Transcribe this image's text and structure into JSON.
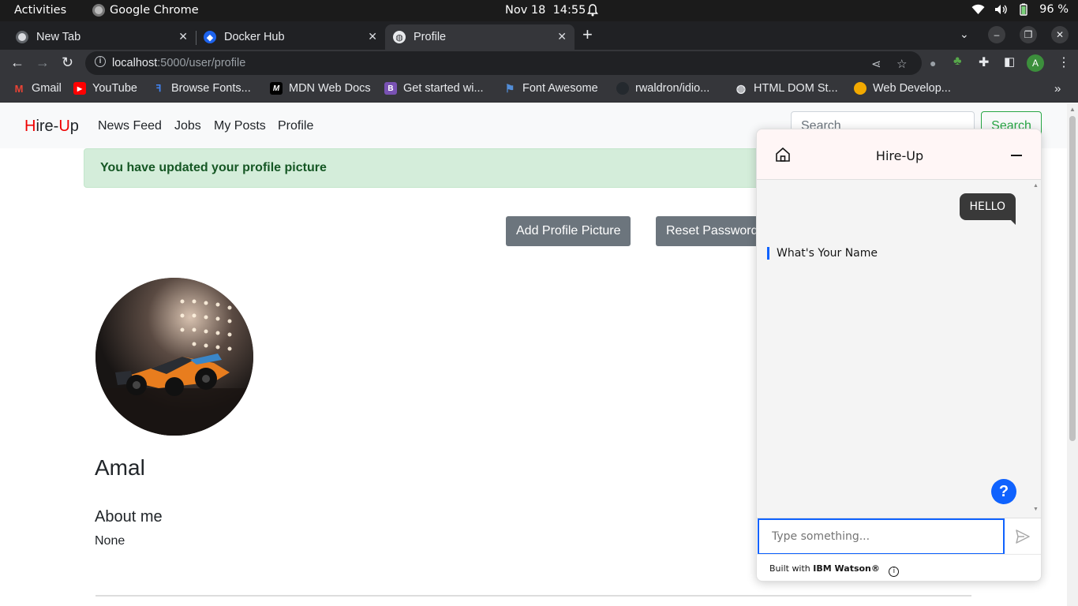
{
  "system": {
    "activities": "Activities",
    "app_name": "Google Chrome",
    "date": "Nov 18",
    "time": "14:55",
    "battery": "96 %"
  },
  "tabs": [
    {
      "title": "New Tab",
      "icon": "chrome-icon"
    },
    {
      "title": "Docker Hub",
      "icon": "docker-icon"
    },
    {
      "title": "Profile",
      "icon": "globe-icon",
      "active": true
    }
  ],
  "address": {
    "host": "localhost",
    "path": ":5000/user/profile"
  },
  "bookmarks": [
    {
      "label": "Gmail",
      "color": "#ea4335",
      "glyph": "M"
    },
    {
      "label": "YouTube",
      "color": "#ff0000",
      "glyph": "▶"
    },
    {
      "label": "Browse Fonts...",
      "color": "#4285f4",
      "glyph": "G"
    },
    {
      "label": "MDN Web Docs",
      "color": "#000000",
      "glyph": "M"
    },
    {
      "label": "Get started wi...",
      "color": "#7952b3",
      "glyph": "B"
    },
    {
      "label": "Font Awesome",
      "color": "#528dd7",
      "glyph": "⚑"
    },
    {
      "label": "rwaldron/idio...",
      "color": "#24292e",
      "glyph": "●"
    },
    {
      "label": "HTML DOM St...",
      "color": "#555555",
      "glyph": "◍"
    },
    {
      "label": "Web Develop...",
      "color": "#f2a900",
      "glyph": "●"
    }
  ],
  "site": {
    "brand": {
      "h": "H",
      "ire": "ire-",
      "u": "U",
      "p": "p"
    },
    "nav": [
      "News Feed",
      "Jobs",
      "My Posts",
      "Profile"
    ],
    "search_placeholder": "Search",
    "search_button": "Search",
    "alert": "You have updated your profile picture",
    "add_picture": "Add Profile Picture",
    "reset_password": "Reset Password",
    "name": "Amal",
    "about_heading": "About me",
    "about_value": "None"
  },
  "chat": {
    "title": "Hire-Up",
    "user_message": "HELLO",
    "bot_message": "What's Your Name",
    "input_placeholder": "Type something...",
    "footer_prefix": "Built with",
    "footer_brand": "IBM Watson®",
    "help_label": "?"
  }
}
